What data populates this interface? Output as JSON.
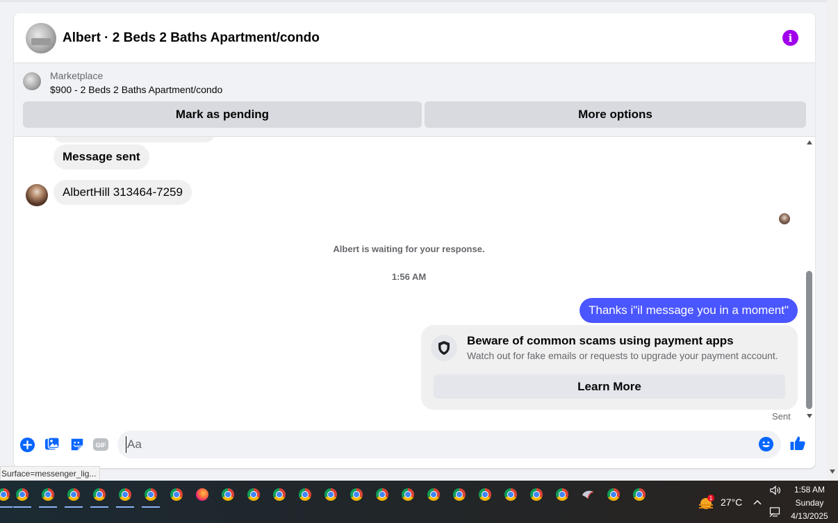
{
  "header": {
    "title": "Albert · 2 Beds 2 Baths Apartment/condo",
    "info_icon": "info-icon",
    "info_color": "#a000ea"
  },
  "marketplace": {
    "label": "Marketplace",
    "listing": "$900 - 2 Beds 2 Baths Apartment/condo",
    "mark_pending_label": "Mark as pending",
    "more_options_label": "More options"
  },
  "messages": {
    "incoming_1": "Message sent",
    "incoming_2": "AlbertHill 313464-7259",
    "waiting_notice": "Albert is waiting for your response.",
    "timestamp": "1:56 AM",
    "outgoing_1": "Thanks i\"il message you in a moment\"",
    "outgoing_color": "#4a56ff"
  },
  "scam_warning": {
    "title": "Beware of common scams using payment apps",
    "subtitle": "Watch out for fake emails or requests to upgrade your payment account.",
    "learn_more_label": "Learn More"
  },
  "status": {
    "sent": "Sent"
  },
  "composer": {
    "placeholder": "Aa",
    "accent_color": "#0866ff"
  },
  "browser_status": {
    "text": "Surface=messenger_lig..."
  },
  "taskbar": {
    "temperature": "27°C",
    "weather_badge": "1",
    "time": "1:58 AM",
    "day": "Sunday",
    "date": "4/13/2025"
  }
}
